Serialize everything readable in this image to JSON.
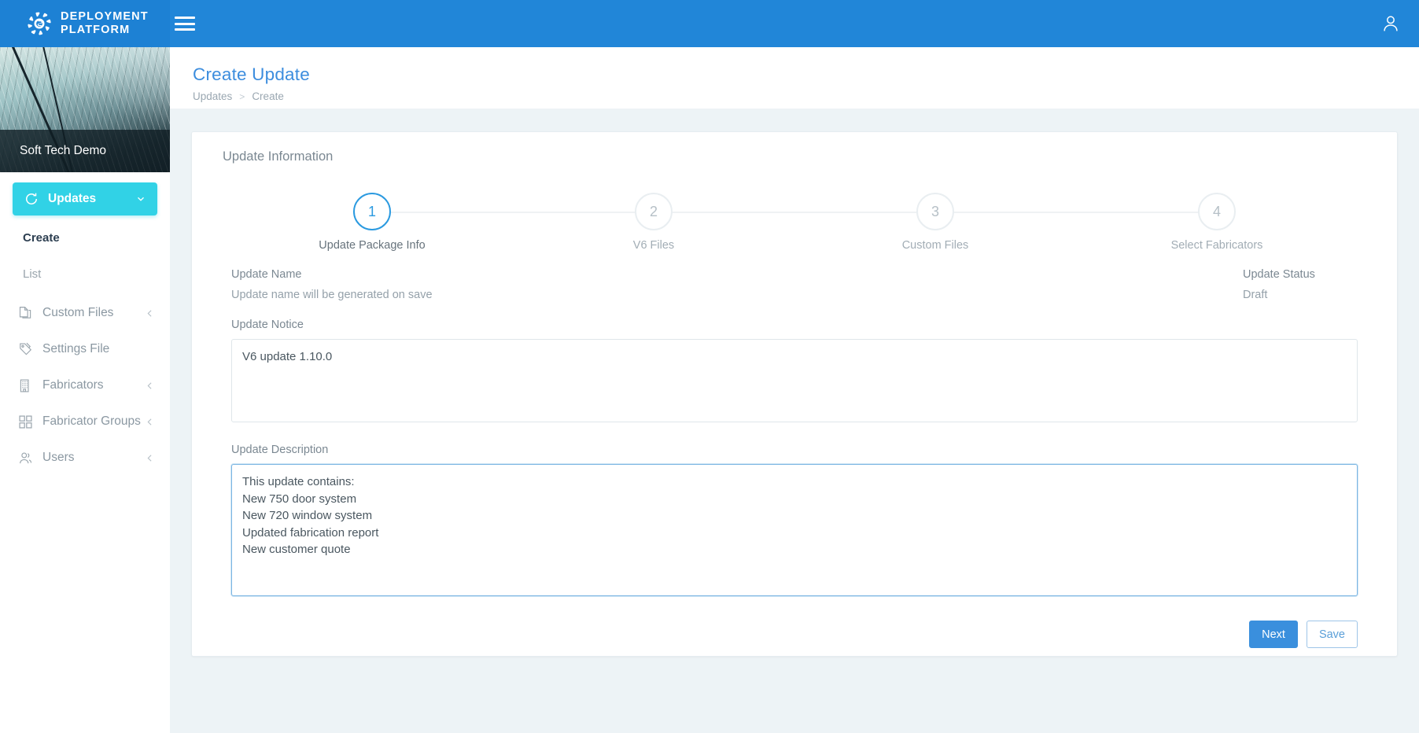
{
  "topbar": {
    "brand_name": "DEPLOYMENT\nPLATFORM",
    "brand_logo_icon": "shutter-logo-icon",
    "menu_icon": "hamburger-menu-icon",
    "account_icon": "user-account-icon"
  },
  "sidebar": {
    "tenant_name": "Soft Tech Demo",
    "active_group": {
      "label": "Updates",
      "icon": "refresh-circle-icon",
      "caret": "chevron-down-icon"
    },
    "sub_items": [
      {
        "label": "Create",
        "state": "current"
      },
      {
        "label": "List",
        "state": "muted"
      }
    ],
    "items": [
      {
        "label": "Custom Files",
        "icon": "copy-files-icon",
        "caret": "chevron-left-icon"
      },
      {
        "label": "Settings File",
        "icon": "tag-settings-icon",
        "caret": ""
      },
      {
        "label": "Fabricators",
        "icon": "building-icon",
        "caret": "chevron-left-icon"
      },
      {
        "label": "Fabricator Groups",
        "icon": "grid-squares-icon",
        "caret": "chevron-left-icon"
      },
      {
        "label": "Users",
        "icon": "users-icon",
        "caret": "chevron-left-icon"
      }
    ]
  },
  "page": {
    "title": "Create Update",
    "breadcrumb": [
      {
        "label": "Updates"
      },
      {
        "label": "Create"
      }
    ],
    "breadcrumb_separator": ">"
  },
  "card": {
    "title": "Update Information",
    "stepper": {
      "active_index": 0,
      "steps": [
        {
          "number": "1",
          "label": "Update Package Info"
        },
        {
          "number": "2",
          "label": "V6 Files"
        },
        {
          "number": "3",
          "label": "Custom Files"
        },
        {
          "number": "4",
          "label": "Select Fabricators"
        }
      ]
    },
    "update_name": {
      "label": "Update Name",
      "value": "Update name will be generated on save"
    },
    "update_status": {
      "label": "Update Status",
      "value": "Draft"
    },
    "update_notice": {
      "label": "Update Notice",
      "value": "V6 update 1.10.0",
      "placeholder": ""
    },
    "update_description": {
      "label": "Update Description",
      "value": "This update contains:\nNew 750 door system\nNew 720 window system\nUpdated fabrication report\nNew customer quote",
      "placeholder": "",
      "focused": true
    },
    "buttons": {
      "next_label": "Next",
      "save_label": "Save"
    }
  },
  "colors": {
    "topbar_blue": "#2186d8",
    "accent_cyan": "#31d2e6",
    "title_blue": "#3c8dde",
    "primary_button": "#3a8fdd",
    "page_background": "#edf3f6"
  }
}
